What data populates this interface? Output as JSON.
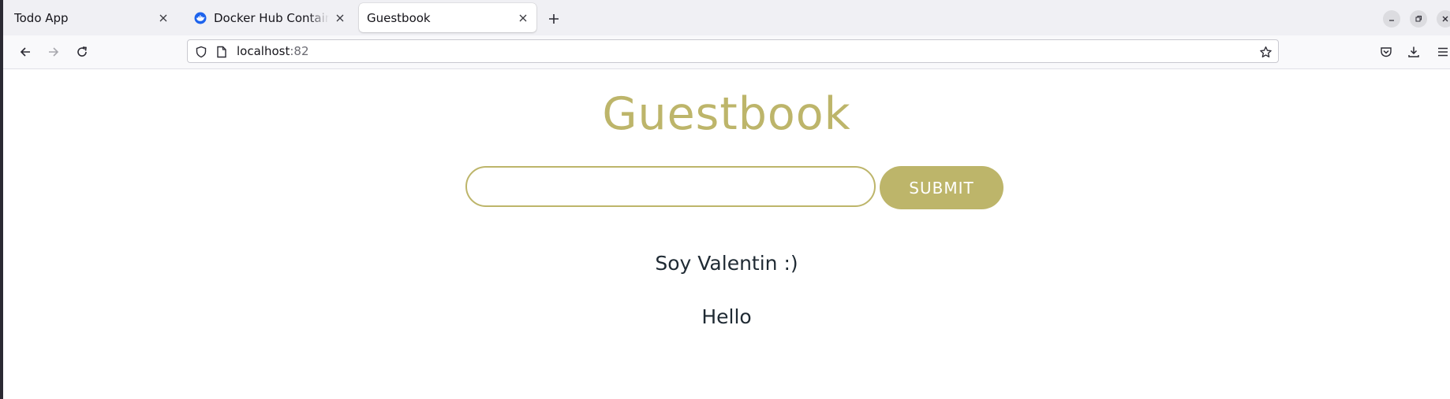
{
  "browser": {
    "tabs": [
      {
        "title": "Todo App"
      },
      {
        "title": "Docker Hub Container Image Library"
      },
      {
        "title": "Guestbook"
      }
    ],
    "url_host": "localhost",
    "url_port": ":82"
  },
  "page": {
    "title": "Guestbook",
    "input_value": "",
    "submit_label": "SUBMIT",
    "entries": [
      "Soy Valentin :)",
      "Hello"
    ]
  },
  "colors": {
    "accent": "#bdb56a",
    "text": "#1f2a33"
  }
}
